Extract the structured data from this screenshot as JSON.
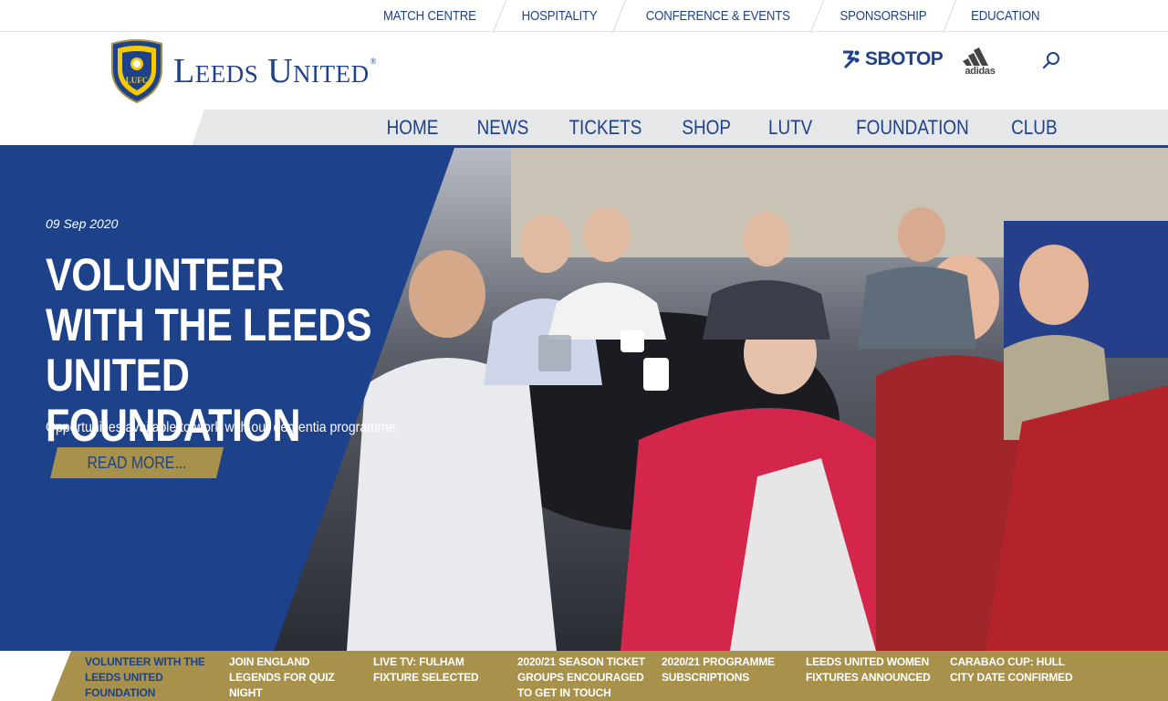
{
  "top_links": [
    "MATCH CENTRE",
    "HOSPITALITY",
    "CONFERENCE & EVENTS",
    "SPONSORSHIP",
    "EDUCATION"
  ],
  "header": {
    "brand": "Leeds United",
    "brand_reg": "®",
    "crest_text": "LUFC",
    "sponsor": "SBOTOP",
    "kit_partner": "adidas"
  },
  "nav": {
    "items": [
      "HOME",
      "NEWS",
      "TICKETS",
      "SHOP",
      "LUTV",
      "FOUNDATION",
      "CLUB"
    ],
    "active": "HOME"
  },
  "hero": {
    "date": "09 Sep 2020",
    "title": "VOLUNTEER WITH THE LEEDS UNITED FOUNDATION",
    "subtitle": "Opportunities available to work with our dementia programme.",
    "cta": "READ MORE..."
  },
  "ticker": [
    "VOLUNTEER WITH THE LEEDS UNITED FOUNDATION",
    "JOIN ENGLAND LEGENDS FOR QUIZ NIGHT",
    "LIVE TV: FULHAM FIXTURE SELECTED",
    "2020/21 SEASON TICKET GROUPS ENCOURAGED TO GET IN TOUCH",
    "2020/21 PROGRAMME SUBSCRIPTIONS",
    "LEEDS UNITED WOMEN FIXTURES ANNOUNCED",
    "CARABAO CUP: HULL CITY DATE CONFIRMED"
  ],
  "colors": {
    "brand_blue": "#1d428a",
    "gold": "#a8914a",
    "nav_grey": "#e6e7e9",
    "crest_yellow": "#f6c900"
  }
}
